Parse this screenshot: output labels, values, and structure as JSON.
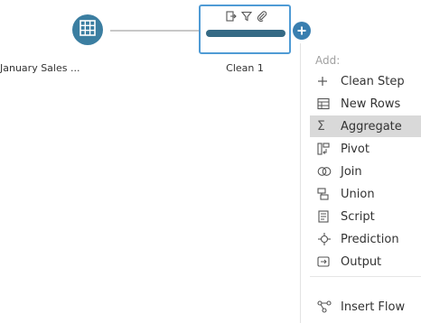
{
  "flow": {
    "input_node": {
      "label": "January Sales ...",
      "icon": "table-icon"
    },
    "clean_node": {
      "label": "Clean 1",
      "icons": [
        "step-icon",
        "filter-icon",
        "attachment-icon"
      ]
    },
    "add_button": {
      "icon": "plus-icon"
    }
  },
  "menu": {
    "header": "Add:",
    "items": [
      {
        "label": "Clean Step",
        "icon": "plus-icon"
      },
      {
        "label": "New Rows",
        "icon": "new-rows-icon"
      },
      {
        "label": "Aggregate",
        "icon": "sigma-icon",
        "highlighted": true
      },
      {
        "label": "Pivot",
        "icon": "pivot-icon"
      },
      {
        "label": "Join",
        "icon": "join-icon"
      },
      {
        "label": "Union",
        "icon": "union-icon"
      },
      {
        "label": "Script",
        "icon": "script-icon"
      },
      {
        "label": "Prediction",
        "icon": "prediction-icon"
      },
      {
        "label": "Output",
        "icon": "output-icon"
      }
    ],
    "footer_item": {
      "label": "Insert Flow",
      "icon": "insert-flow-icon"
    }
  },
  "colors": {
    "node_blue": "#3b7ea1",
    "selection_border": "#4f9bd5",
    "clean_bar": "#356a85",
    "highlight": "#d9d9d9"
  }
}
